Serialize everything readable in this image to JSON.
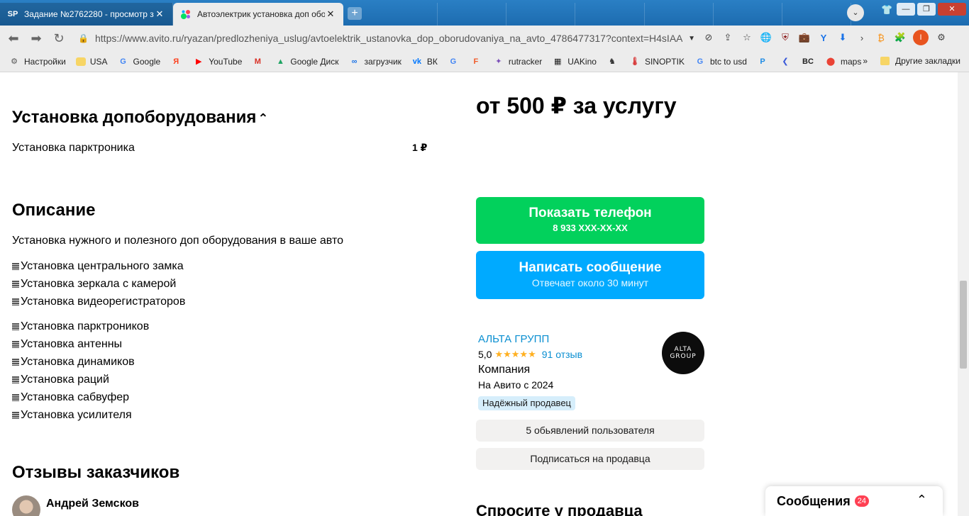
{
  "browser": {
    "tabs": [
      {
        "favicon": "SP",
        "title": "Задание №2762280 - просмотр з",
        "close": "✕"
      },
      {
        "favicon": "●",
        "title": "Автоэлектрик установка доп обо",
        "close": "✕"
      }
    ],
    "new_tab": "+",
    "address": "https://www.avito.ru/ryazan/predlozheniya_uslug/avtoelektrik_ustanovka_dop_oborudovaniya_na_avto_4786477317?context=H4sIAA...",
    "bookmarks": [
      {
        "icon": "gear-icon",
        "glyph": "⚙",
        "label": "Настройки",
        "color": "#555"
      },
      {
        "icon": "folder-icon",
        "glyph": "",
        "label": "USA",
        "color": "#f7d565"
      },
      {
        "icon": "google-icon",
        "glyph": "G",
        "label": "Google",
        "color": "#4285f4"
      },
      {
        "icon": "yandex-icon",
        "glyph": "Я",
        "label": "",
        "color": "#fc3f1d"
      },
      {
        "icon": "youtube-icon",
        "glyph": "▶",
        "label": "YouTube",
        "color": "#ff0000"
      },
      {
        "icon": "gmail-icon",
        "glyph": "M",
        "label": "",
        "color": "#d93025"
      },
      {
        "icon": "google-drive-icon",
        "glyph": "▲",
        "label": "Google Диск",
        "color": "#1fa463"
      },
      {
        "icon": "infinity-icon",
        "glyph": "∞",
        "label": "загрузчик",
        "color": "#1a73e8"
      },
      {
        "icon": "vk-icon",
        "glyph": "vk",
        "label": "ВК",
        "color": "#0077ff"
      },
      {
        "icon": "translate-icon",
        "glyph": "G",
        "label": "",
        "color": "#4285f4"
      },
      {
        "icon": "f-icon",
        "glyph": "F",
        "label": "",
        "color": "#f05a28"
      },
      {
        "icon": "rutracker-icon",
        "glyph": "✦",
        "label": "rutracker",
        "color": "#7b4fb8"
      },
      {
        "icon": "uakino-icon",
        "glyph": "▦",
        "label": "UAKino",
        "color": "#222"
      },
      {
        "icon": "chess-icon",
        "glyph": "♞",
        "label": "",
        "color": "#333"
      },
      {
        "icon": "thermometer-icon",
        "glyph": "🌡",
        "label": "SINOPTIK",
        "color": "#d62b2b"
      },
      {
        "icon": "google-icon",
        "glyph": "G",
        "label": "btc to usd",
        "color": "#4285f4"
      },
      {
        "icon": "p-icon",
        "glyph": "P",
        "label": "",
        "color": "#1f8ce5"
      },
      {
        "icon": "arrow-icon",
        "glyph": "❮",
        "label": "",
        "color": "#3a5ad9"
      },
      {
        "icon": "bc-icon",
        "glyph": "BC",
        "label": "",
        "color": "#222"
      },
      {
        "icon": "maps-icon",
        "glyph": "⬤",
        "label": "maps",
        "color": "#ea4335"
      }
    ],
    "bookmarks_more": "»",
    "other_bookmarks": "Другие закладки"
  },
  "content": {
    "equip_title": "Установка допоборудования",
    "equip_chevron": "⌃",
    "equip_item": "Установка парктроника",
    "equip_price": "1 ₽",
    "desc_title": "Описание",
    "desc_intro": "Установка нужного и полезного доп оборудования в ваше авто",
    "bullets_group1": [
      "Установка центрального замка",
      "Установка зеркала с камерой",
      "Установка видеорегистраторов"
    ],
    "bullets_group2": [
      "Установка парктроников",
      "Установка антенны",
      "Установка динамиков",
      "Установка раций",
      "Установка сабвуфер",
      "Установка усилителя"
    ],
    "reviews_title": "Отзывы заказчиков",
    "reviewer_name": "Андрей Земсков"
  },
  "sidebar": {
    "price": "от 500 ₽ за услугу",
    "phone_btn_label": "Показать телефон",
    "phone_btn_number": "8 933 XXX-XX-XX",
    "msg_btn_label": "Написать сообщение",
    "msg_btn_sub": "Отвечает около 30 минут",
    "seller_name": "АЛЬТА ГРУПП",
    "rating_value": "5,0",
    "rating_stars": "★★★★★",
    "reviews_link": "91 отзыв",
    "seller_type": "Компания",
    "seller_since": "На Авито с 2024",
    "badge": "Надёжный продавец",
    "logo_line1": "ALTA",
    "logo_line2": "GROUP",
    "listings_btn": "5 обьявлений пользователя",
    "subscribe_btn": "Подписаться на продавца",
    "ask_title": "Спросите у продавца"
  },
  "messages_widget": {
    "title": "Сообщения",
    "count": "24",
    "chevron": "⌃"
  }
}
